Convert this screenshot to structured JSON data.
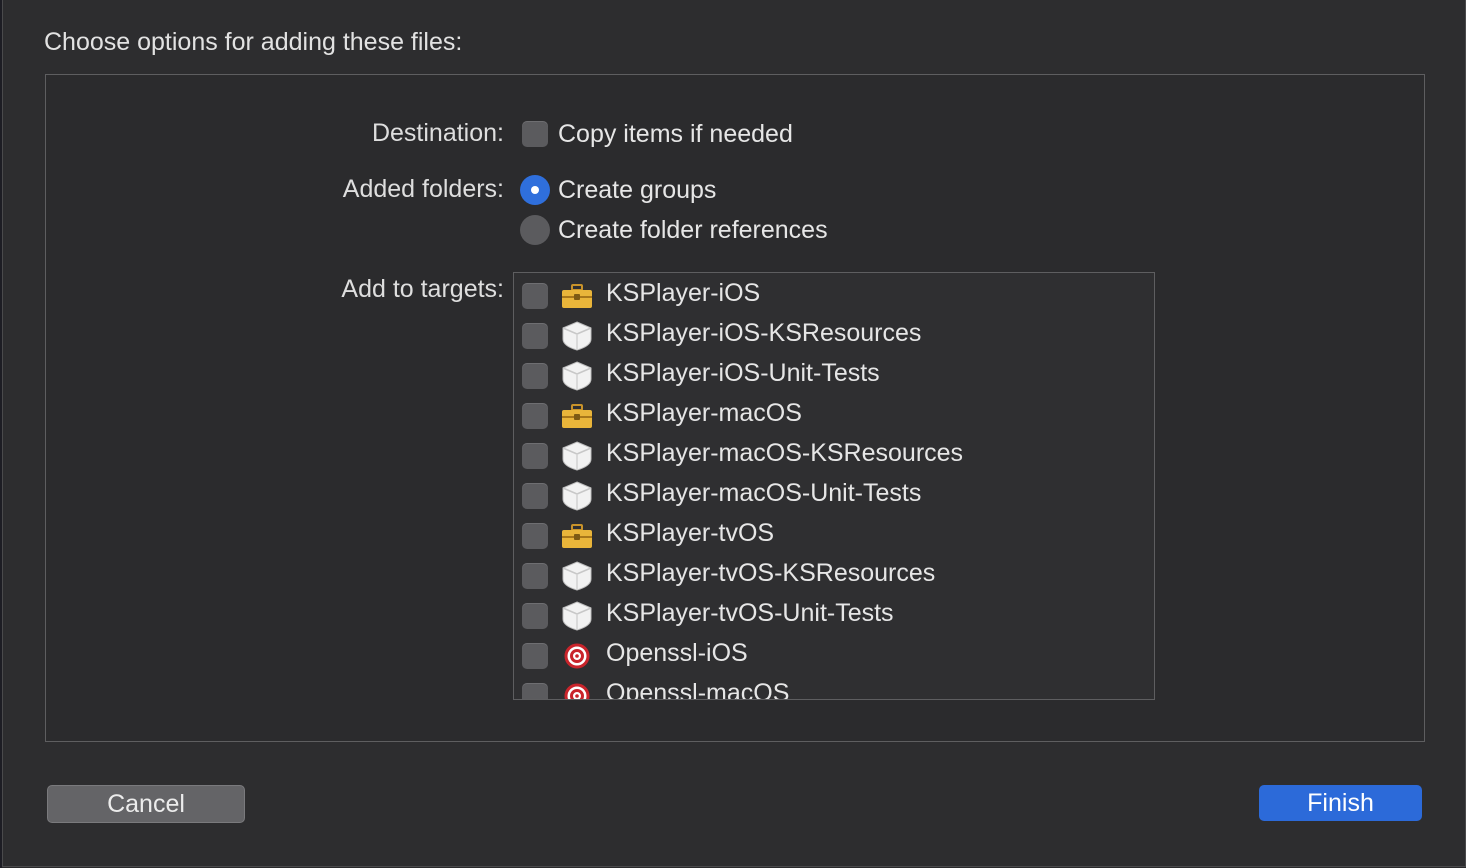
{
  "dialog": {
    "header": "Choose options for adding these files:",
    "destination": {
      "label": "Destination:",
      "option": "Copy items if needed",
      "checked": false
    },
    "added_folders": {
      "label": "Added folders:",
      "options": [
        {
          "text": "Create groups",
          "selected": true
        },
        {
          "text": "Create folder references",
          "selected": false
        }
      ]
    },
    "targets": {
      "label": "Add to targets:",
      "items": [
        {
          "name": "KSPlayer-iOS",
          "icon": "toolbox-icon",
          "checked": false
        },
        {
          "name": "KSPlayer-iOS-KSResources",
          "icon": "bundle-icon",
          "checked": false
        },
        {
          "name": "KSPlayer-iOS-Unit-Tests",
          "icon": "bundle-icon",
          "checked": false
        },
        {
          "name": "KSPlayer-macOS",
          "icon": "toolbox-icon",
          "checked": false
        },
        {
          "name": "KSPlayer-macOS-KSResources",
          "icon": "bundle-icon",
          "checked": false
        },
        {
          "name": "KSPlayer-macOS-Unit-Tests",
          "icon": "bundle-icon",
          "checked": false
        },
        {
          "name": "KSPlayer-tvOS",
          "icon": "toolbox-icon",
          "checked": false
        },
        {
          "name": "KSPlayer-tvOS-KSResources",
          "icon": "bundle-icon",
          "checked": false
        },
        {
          "name": "KSPlayer-tvOS-Unit-Tests",
          "icon": "bundle-icon",
          "checked": false
        },
        {
          "name": "Openssl-iOS",
          "icon": "target-icon",
          "checked": false
        },
        {
          "name": "Openssl-macOS",
          "icon": "target-icon",
          "checked": false
        }
      ]
    },
    "buttons": {
      "cancel": "Cancel",
      "finish": "Finish"
    },
    "colors": {
      "accent": "#2c6ad9",
      "background": "#2d2d2f"
    }
  }
}
